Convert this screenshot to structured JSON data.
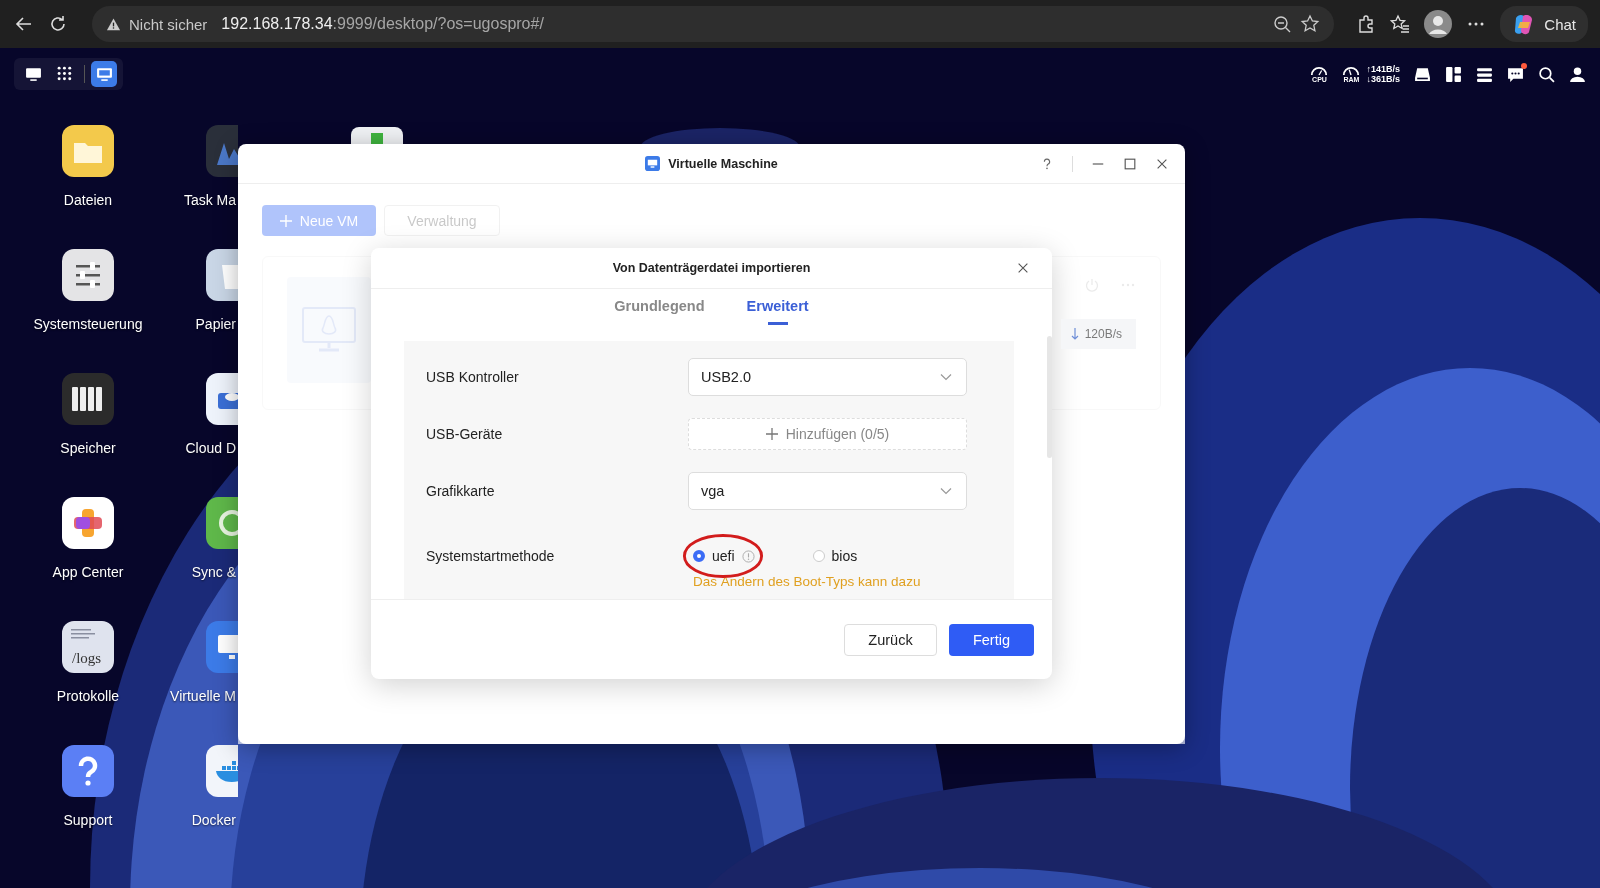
{
  "browser": {
    "security_label": "Nicht sicher",
    "url_host": "192.168.178.34",
    "url_path": ":9999/desktop/?os=ugospro#/",
    "chat_label": "Chat"
  },
  "taskbar": {
    "apps": [
      {
        "kind": "desktop",
        "selected": false
      },
      {
        "kind": "launcher",
        "selected": false
      },
      {
        "kind": "vm",
        "selected": true
      }
    ],
    "cpu_label": "CPU",
    "ram_label": "RAM",
    "upload": "↑141B/s",
    "download": "↓361B/s",
    "has_notification": true
  },
  "desktop_icons": [
    {
      "kind": "files",
      "label": "Dateien"
    },
    {
      "kind": "taskmanager",
      "label": "Task Ma"
    },
    {
      "kind": "settings",
      "label": "Systemsteuerung"
    },
    {
      "kind": "trash",
      "label": "Papier"
    },
    {
      "kind": "storage",
      "label": "Speicher"
    },
    {
      "kind": "cloud",
      "label": "Cloud D"
    },
    {
      "kind": "appcenter",
      "label": "App Center"
    },
    {
      "kind": "sync",
      "label": "Sync &"
    },
    {
      "kind": "logs",
      "label": "Protokolle",
      "icon_text": "/logs"
    },
    {
      "kind": "vm",
      "label": "Virtuelle M"
    },
    {
      "kind": "support",
      "label": "Support"
    },
    {
      "kind": "docker",
      "label": "Docker"
    }
  ],
  "window": {
    "title": "Virtuelle Maschine",
    "toolbar": [
      {
        "kind": "primary",
        "label": "Neue VM"
      },
      {
        "kind": "secondary",
        "label": "Verwaltung"
      }
    ],
    "vm_card": {
      "download_rate": "120B/s"
    }
  },
  "dialog": {
    "title": "Von Datenträgerdatei importieren",
    "tabs": [
      {
        "label": "Grundlegend",
        "selected": false
      },
      {
        "label": "Erweitert",
        "selected": true
      }
    ],
    "fields": [
      {
        "kind": "select",
        "label": "USB Kontroller",
        "value": "USB2.0"
      },
      {
        "kind": "add",
        "label": "USB-Geräte",
        "button": "Hinzufügen (0/5)"
      },
      {
        "kind": "select",
        "label": "Grafikkarte",
        "value": "vga"
      },
      {
        "kind": "radio",
        "label": "Systemstartmethode",
        "options": [
          {
            "label": "uefi",
            "selected": true,
            "info": true
          },
          {
            "label": "bios",
            "selected": false,
            "info": false
          }
        ],
        "warning": "Das Ändern des Boot-Typs kann dazu"
      }
    ],
    "buttons": [
      {
        "kind": "secondary",
        "label": "Zurück"
      },
      {
        "kind": "primary",
        "label": "Fertig"
      }
    ]
  }
}
